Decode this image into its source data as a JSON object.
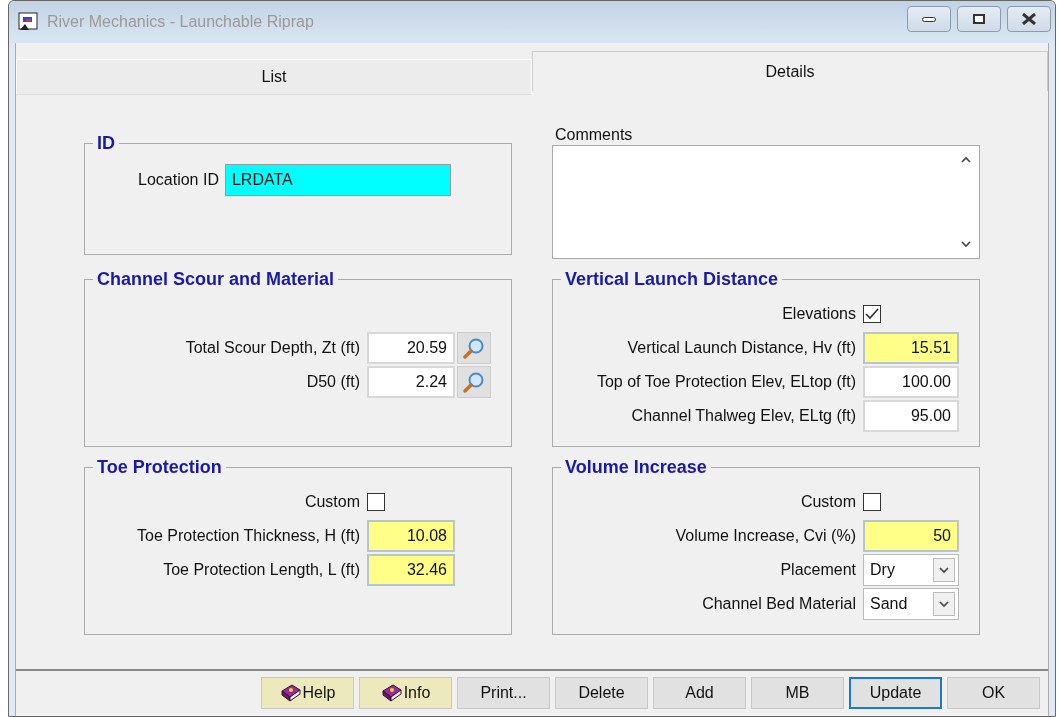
{
  "window": {
    "title": "River Mechanics - Launchable Riprap"
  },
  "tabs": [
    {
      "label": "List",
      "selected": false
    },
    {
      "label": "Details",
      "selected": true
    }
  ],
  "id_group": {
    "title": "ID",
    "label": "Location ID",
    "value": "LRDATA"
  },
  "comments": {
    "label": "Comments"
  },
  "groups": [
    {
      "title": "Channel Scour and Material",
      "rows": [
        {
          "kind": "field",
          "label": "Total Scour Depth, Zt (ft)",
          "value": "20.59",
          "computed": false,
          "lookup": true
        },
        {
          "kind": "field",
          "label": "D50 (ft)",
          "value": "2.24",
          "computed": false,
          "lookup": true
        }
      ]
    },
    {
      "title": "Vertical Launch Distance",
      "rows": [
        {
          "kind": "checkbox",
          "label": "Elevations",
          "checked": true
        },
        {
          "kind": "field",
          "label": "Vertical Launch Distance, Hv (ft)",
          "value": "15.51",
          "computed": true,
          "lookup": false
        },
        {
          "kind": "field",
          "label": "Top of Toe Protection Elev, ELtop (ft)",
          "value": "100.00",
          "computed": false,
          "lookup": false
        },
        {
          "kind": "field",
          "label": "Channel Thalweg Elev, ELtg (ft)",
          "value": "95.00",
          "computed": false,
          "lookup": false
        }
      ]
    },
    {
      "title": "Toe Protection",
      "rows": [
        {
          "kind": "checkbox",
          "label": "Custom",
          "checked": false
        },
        {
          "kind": "field",
          "label": "Toe Protection Thickness, H (ft)",
          "value": "10.08",
          "computed": true,
          "lookup": false
        },
        {
          "kind": "field",
          "label": "Toe Protection Length, L (ft)",
          "value": "32.46",
          "computed": true,
          "lookup": false
        }
      ]
    },
    {
      "title": "Volume Increase",
      "rows": [
        {
          "kind": "checkbox",
          "label": "Custom",
          "checked": false
        },
        {
          "kind": "field",
          "label": "Volume Increase, Cvi (%)",
          "value": "50",
          "computed": true,
          "lookup": false
        },
        {
          "kind": "select",
          "label": "Placement",
          "value": "Dry"
        },
        {
          "kind": "select",
          "label": "Channel Bed Material",
          "value": "Sand"
        }
      ]
    }
  ],
  "buttons": [
    {
      "label": "Help",
      "kind": "help",
      "focused": false
    },
    {
      "label": "Info",
      "kind": "help",
      "focused": false
    },
    {
      "label": "Print...",
      "kind": "plain",
      "focused": false
    },
    {
      "label": "Delete",
      "kind": "plain",
      "focused": false
    },
    {
      "label": "Add",
      "kind": "plain",
      "focused": false
    },
    {
      "label": "MB",
      "kind": "plain",
      "focused": false
    },
    {
      "label": "Update",
      "kind": "plain",
      "focused": true
    },
    {
      "label": "OK",
      "kind": "plain",
      "focused": false
    }
  ]
}
